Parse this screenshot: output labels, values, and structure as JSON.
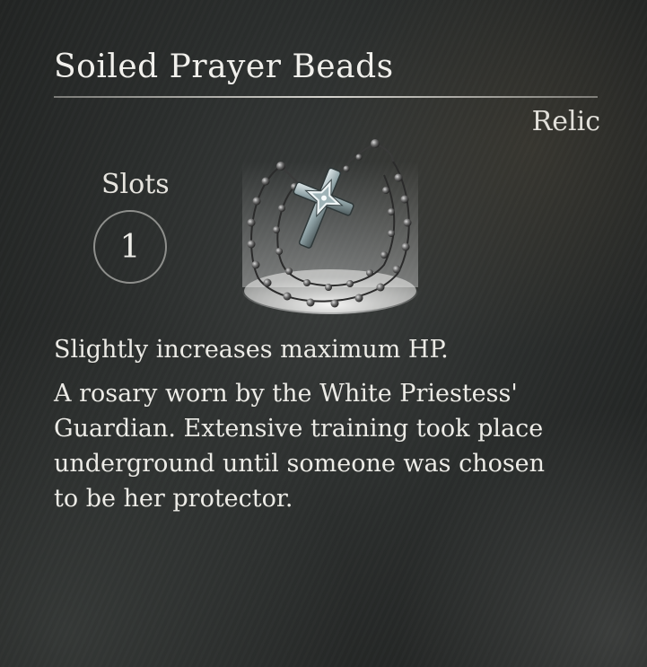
{
  "item": {
    "name": "Soiled Prayer Beads",
    "category": "Relic",
    "slots_label": "Slots",
    "slots_value": "1",
    "effect": "Slightly increases maximum HP.",
    "lore": "A rosary worn by the White Priestess' Guardian. Extensive training took place underground until someone was chosen to be her protector.",
    "icon": "rosary-beads-icon"
  },
  "colors": {
    "text": "#ecebe6",
    "slot_ring": "#8e8f8c",
    "background": "#2a2c2b"
  }
}
